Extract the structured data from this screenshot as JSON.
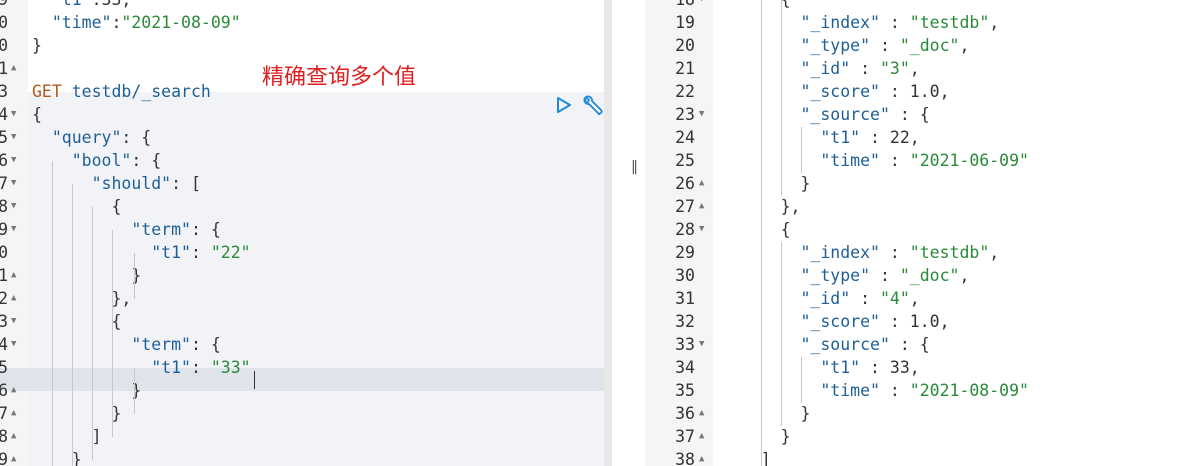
{
  "annotation": "精确查询多个值",
  "left_editor": {
    "lines": [
      {
        "num": "9",
        "fold": "",
        "tokens": [
          {
            "t": "  ",
            "c": ""
          },
          {
            "t": "\"t1\"",
            "c": "tk-key"
          },
          {
            "t": ":33,",
            "c": "tk-punc"
          }
        ]
      },
      {
        "num": "0",
        "fold": "",
        "tokens": [
          {
            "t": "  ",
            "c": ""
          },
          {
            "t": "\"time\"",
            "c": "tk-key"
          },
          {
            "t": ":",
            "c": "tk-punc"
          },
          {
            "t": "\"2021-08-09\"",
            "c": "tk-str"
          }
        ]
      },
      {
        "num": "0",
        "fold": "",
        "tokens": [
          {
            "t": "}",
            "c": "tk-punc"
          }
        ]
      },
      {
        "num": "1",
        "fold": "up",
        "tokens": []
      },
      {
        "num": "3",
        "fold": "",
        "tokens": [
          {
            "t": "GET",
            "c": "tk-method"
          },
          {
            "t": " testdb/_search",
            "c": "tk-path"
          }
        ]
      },
      {
        "num": "4",
        "fold": "down",
        "tokens": [
          {
            "t": "{",
            "c": "tk-punc"
          }
        ]
      },
      {
        "num": "5",
        "fold": "down",
        "tokens": [
          {
            "t": "  ",
            "c": ""
          },
          {
            "t": "\"query\"",
            "c": "tk-key"
          },
          {
            "t": ": {",
            "c": "tk-punc"
          }
        ]
      },
      {
        "num": "6",
        "fold": "down",
        "tokens": [
          {
            "t": "    ",
            "c": ""
          },
          {
            "t": "\"bool\"",
            "c": "tk-key"
          },
          {
            "t": ": {",
            "c": "tk-punc"
          }
        ]
      },
      {
        "num": "7",
        "fold": "down",
        "tokens": [
          {
            "t": "      ",
            "c": ""
          },
          {
            "t": "\"should\"",
            "c": "tk-key"
          },
          {
            "t": ": [",
            "c": "tk-punc"
          }
        ]
      },
      {
        "num": "8",
        "fold": "down",
        "tokens": [
          {
            "t": "        {",
            "c": "tk-punc"
          }
        ]
      },
      {
        "num": "9",
        "fold": "down",
        "tokens": [
          {
            "t": "          ",
            "c": ""
          },
          {
            "t": "\"term\"",
            "c": "tk-key"
          },
          {
            "t": ": {",
            "c": "tk-punc"
          }
        ]
      },
      {
        "num": "0",
        "fold": "",
        "tokens": [
          {
            "t": "            ",
            "c": ""
          },
          {
            "t": "\"t1\"",
            "c": "tk-key"
          },
          {
            "t": ": ",
            "c": "tk-punc"
          },
          {
            "t": "\"22\"",
            "c": "tk-str"
          }
        ]
      },
      {
        "num": "1",
        "fold": "up",
        "tokens": [
          {
            "t": "          }",
            "c": "tk-punc"
          }
        ]
      },
      {
        "num": "2",
        "fold": "up",
        "tokens": [
          {
            "t": "        },",
            "c": "tk-punc"
          }
        ]
      },
      {
        "num": "3",
        "fold": "down",
        "tokens": [
          {
            "t": "        {",
            "c": "tk-punc"
          }
        ]
      },
      {
        "num": "4",
        "fold": "down",
        "tokens": [
          {
            "t": "          ",
            "c": ""
          },
          {
            "t": "\"term\"",
            "c": "tk-key"
          },
          {
            "t": ": {",
            "c": "tk-punc"
          }
        ]
      },
      {
        "num": "5",
        "fold": "",
        "tokens": [
          {
            "t": "            ",
            "c": ""
          },
          {
            "t": "\"t1\"",
            "c": "tk-key"
          },
          {
            "t": ": ",
            "c": "tk-punc"
          },
          {
            "t": "\"33\"",
            "c": "tk-str"
          }
        ]
      },
      {
        "num": "6",
        "fold": "up",
        "tokens": [
          {
            "t": "          }",
            "c": "tk-punc"
          }
        ]
      },
      {
        "num": "7",
        "fold": "up",
        "tokens": [
          {
            "t": "        }",
            "c": "tk-punc"
          }
        ]
      },
      {
        "num": "8",
        "fold": "up",
        "tokens": [
          {
            "t": "      ]",
            "c": "tk-punc"
          }
        ]
      },
      {
        "num": "9",
        "fold": "up",
        "tokens": [
          {
            "t": "    }",
            "c": "tk-punc"
          }
        ]
      }
    ]
  },
  "right_editor": {
    "lines": [
      {
        "num": "18",
        "fold": "down",
        "tokens": [
          {
            "t": "      {",
            "c": "tk-punc"
          }
        ]
      },
      {
        "num": "19",
        "fold": "",
        "tokens": [
          {
            "t": "        ",
            "c": ""
          },
          {
            "t": "\"_index\"",
            "c": "tk-key"
          },
          {
            "t": " : ",
            "c": "tk-punc"
          },
          {
            "t": "\"testdb\"",
            "c": "tk-str"
          },
          {
            "t": ",",
            "c": "tk-punc"
          }
        ]
      },
      {
        "num": "20",
        "fold": "",
        "tokens": [
          {
            "t": "        ",
            "c": ""
          },
          {
            "t": "\"_type\"",
            "c": "tk-key"
          },
          {
            "t": " : ",
            "c": "tk-punc"
          },
          {
            "t": "\"_doc\"",
            "c": "tk-str"
          },
          {
            "t": ",",
            "c": "tk-punc"
          }
        ]
      },
      {
        "num": "21",
        "fold": "",
        "tokens": [
          {
            "t": "        ",
            "c": ""
          },
          {
            "t": "\"_id\"",
            "c": "tk-key"
          },
          {
            "t": " : ",
            "c": "tk-punc"
          },
          {
            "t": "\"3\"",
            "c": "tk-str"
          },
          {
            "t": ",",
            "c": "tk-punc"
          }
        ]
      },
      {
        "num": "22",
        "fold": "",
        "tokens": [
          {
            "t": "        ",
            "c": ""
          },
          {
            "t": "\"_score\"",
            "c": "tk-key"
          },
          {
            "t": " : 1.0,",
            "c": "tk-punc"
          }
        ]
      },
      {
        "num": "23",
        "fold": "down",
        "tokens": [
          {
            "t": "        ",
            "c": ""
          },
          {
            "t": "\"_source\"",
            "c": "tk-key"
          },
          {
            "t": " : {",
            "c": "tk-punc"
          }
        ]
      },
      {
        "num": "24",
        "fold": "",
        "tokens": [
          {
            "t": "          ",
            "c": ""
          },
          {
            "t": "\"t1\"",
            "c": "tk-key"
          },
          {
            "t": " : 22,",
            "c": "tk-punc"
          }
        ]
      },
      {
        "num": "25",
        "fold": "",
        "tokens": [
          {
            "t": "          ",
            "c": ""
          },
          {
            "t": "\"time\"",
            "c": "tk-key"
          },
          {
            "t": " : ",
            "c": "tk-punc"
          },
          {
            "t": "\"2021-06-09\"",
            "c": "tk-str"
          }
        ]
      },
      {
        "num": "26",
        "fold": "up",
        "tokens": [
          {
            "t": "        }",
            "c": "tk-punc"
          }
        ]
      },
      {
        "num": "27",
        "fold": "up",
        "tokens": [
          {
            "t": "      },",
            "c": "tk-punc"
          }
        ]
      },
      {
        "num": "28",
        "fold": "down",
        "tokens": [
          {
            "t": "      {",
            "c": "tk-punc"
          }
        ]
      },
      {
        "num": "29",
        "fold": "",
        "tokens": [
          {
            "t": "        ",
            "c": ""
          },
          {
            "t": "\"_index\"",
            "c": "tk-key"
          },
          {
            "t": " : ",
            "c": "tk-punc"
          },
          {
            "t": "\"testdb\"",
            "c": "tk-str"
          },
          {
            "t": ",",
            "c": "tk-punc"
          }
        ]
      },
      {
        "num": "30",
        "fold": "",
        "tokens": [
          {
            "t": "        ",
            "c": ""
          },
          {
            "t": "\"_type\"",
            "c": "tk-key"
          },
          {
            "t": " : ",
            "c": "tk-punc"
          },
          {
            "t": "\"_doc\"",
            "c": "tk-str"
          },
          {
            "t": ",",
            "c": "tk-punc"
          }
        ]
      },
      {
        "num": "31",
        "fold": "",
        "tokens": [
          {
            "t": "        ",
            "c": ""
          },
          {
            "t": "\"_id\"",
            "c": "tk-key"
          },
          {
            "t": " : ",
            "c": "tk-punc"
          },
          {
            "t": "\"4\"",
            "c": "tk-str"
          },
          {
            "t": ",",
            "c": "tk-punc"
          }
        ]
      },
      {
        "num": "32",
        "fold": "",
        "tokens": [
          {
            "t": "        ",
            "c": ""
          },
          {
            "t": "\"_score\"",
            "c": "tk-key"
          },
          {
            "t": " : 1.0,",
            "c": "tk-punc"
          }
        ]
      },
      {
        "num": "33",
        "fold": "down",
        "tokens": [
          {
            "t": "        ",
            "c": ""
          },
          {
            "t": "\"_source\"",
            "c": "tk-key"
          },
          {
            "t": " : {",
            "c": "tk-punc"
          }
        ]
      },
      {
        "num": "34",
        "fold": "",
        "tokens": [
          {
            "t": "          ",
            "c": ""
          },
          {
            "t": "\"t1\"",
            "c": "tk-key"
          },
          {
            "t": " : 33,",
            "c": "tk-punc"
          }
        ]
      },
      {
        "num": "35",
        "fold": "",
        "tokens": [
          {
            "t": "          ",
            "c": ""
          },
          {
            "t": "\"time\"",
            "c": "tk-key"
          },
          {
            "t": " : ",
            "c": "tk-punc"
          },
          {
            "t": "\"2021-08-09\"",
            "c": "tk-str"
          }
        ]
      },
      {
        "num": "36",
        "fold": "up",
        "tokens": [
          {
            "t": "        }",
            "c": "tk-punc"
          }
        ]
      },
      {
        "num": "37",
        "fold": "up",
        "tokens": [
          {
            "t": "      }",
            "c": "tk-punc"
          }
        ]
      },
      {
        "num": "38",
        "fold": "up",
        "tokens": [
          {
            "t": "    ]",
            "c": "tk-punc"
          }
        ]
      }
    ]
  },
  "icons": {
    "run": "play-icon",
    "settings": "wrench-icon",
    "resize": "resize-handle-icon"
  },
  "colors": {
    "run_icon": "#1f8bd6",
    "wrench_icon": "#1f8bd6",
    "annotation": "#e02020"
  }
}
